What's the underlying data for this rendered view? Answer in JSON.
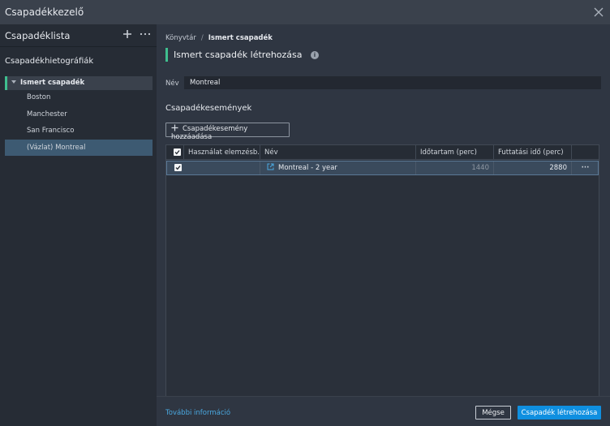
{
  "window": {
    "title": "Csapadékkezelő",
    "close_icon": "close-icon"
  },
  "sidebar": {
    "header_label": "Csapadéklista",
    "section_title": "Csapadékhietográfiák",
    "group": {
      "label": "Ismert csapadék",
      "expanded": true
    },
    "items": [
      {
        "label": "Boston"
      },
      {
        "label": "Manchester"
      },
      {
        "label": "San Francisco"
      },
      {
        "label": "(Vázlat) Montreal",
        "selected": true
      }
    ]
  },
  "breadcrumb": {
    "root": "Könyvtár",
    "separator": "/",
    "current": "Ismert csapadék"
  },
  "page": {
    "title": "Ismert csapadék létrehozása",
    "info_icon": "i"
  },
  "form": {
    "name_label": "Név",
    "name_value": "Montreal"
  },
  "events": {
    "section_title": "Csapadékesemények",
    "add_button_label": "Csapadékesemény hozzáadása",
    "columns": [
      "Használat elemzésb...",
      "Név",
      "Időtartam (perc)",
      "Futtatási idő (perc)"
    ],
    "rows": [
      {
        "use_in_analysis": true,
        "name": "Montreal - 2 year",
        "duration": "1440",
        "run_time": "2880",
        "more": "···"
      }
    ]
  },
  "footer": {
    "more_info_link": "További információ",
    "cancel_label": "Mégse",
    "create_label": "Csapadék létrehozása"
  },
  "colors": {
    "accent_green": "#3fbf8f",
    "primary_blue": "#0f8fe0",
    "link_blue": "#4aa8e0",
    "selected_row": "#3d5a72"
  }
}
